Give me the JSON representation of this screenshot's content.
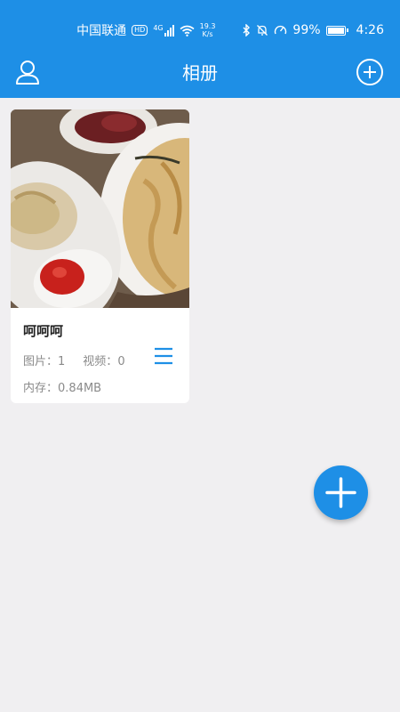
{
  "status_bar": {
    "carrier": "中国联通",
    "hd_badge": "HD",
    "network_type": "4G",
    "speed_value": "19.3",
    "speed_unit": "K/s",
    "battery_percent": "99%",
    "time": "4:26"
  },
  "app_bar": {
    "title": "相册",
    "left_icon": "user-icon",
    "right_icon": "add-circle-icon"
  },
  "albums": [
    {
      "name": "呵呵呵",
      "photos_label": "图片：",
      "photos_count": "1",
      "videos_label": "视频：",
      "videos_count": "0",
      "size_label": "内存：",
      "size_value": "0.84MB",
      "menu_icon": "menu-icon"
    }
  ],
  "fab": {
    "icon": "plus-icon"
  },
  "colors": {
    "primary": "#1e8fe6",
    "background": "#f0eff1",
    "card": "#ffffff",
    "text_muted": "#8a8a8a"
  }
}
